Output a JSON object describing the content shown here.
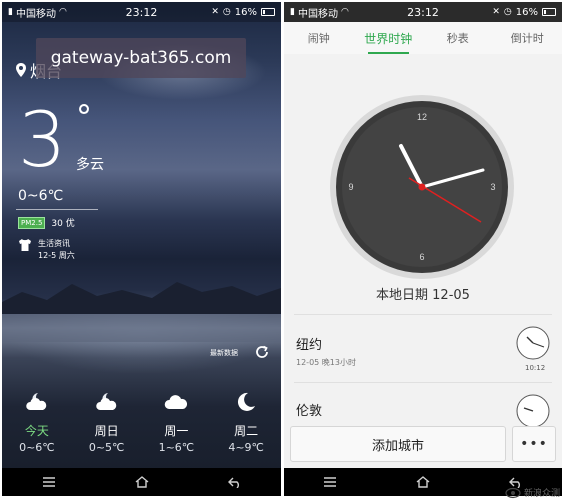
{
  "left": {
    "status": {
      "carrier": "中国移动",
      "time": "23:12",
      "battery": "16%"
    },
    "watermark": "gateway-bat365.com",
    "location": "烟台",
    "temperature": "3",
    "degree_symbol": "°",
    "condition": "多云",
    "range": "0~6℃",
    "aqi": {
      "badge": "PM2.5",
      "value": "30 优"
    },
    "life": {
      "title": "生活资讯",
      "date": "12-5 周六"
    },
    "latest_label": "最新数据",
    "forecast": [
      {
        "name": "今天",
        "range": "0~6℃",
        "icon": "cloudy-night-icon"
      },
      {
        "name": "周日",
        "range": "0~5℃",
        "icon": "cloudy-night-icon"
      },
      {
        "name": "周一",
        "range": "1~6℃",
        "icon": "cloud-icon"
      },
      {
        "name": "周二",
        "range": "4~9℃",
        "icon": "moon-icon"
      }
    ]
  },
  "right": {
    "status": {
      "carrier": "中国移动",
      "time": "23:12",
      "battery": "16%"
    },
    "tabs": [
      {
        "label": "闹钟"
      },
      {
        "label": "世界时钟"
      },
      {
        "label": "秒表"
      },
      {
        "label": "倒计时"
      }
    ],
    "clock_numbers": {
      "twelve": "12",
      "three": "3",
      "six": "6",
      "nine": "9"
    },
    "local_date": "本地日期 12-05",
    "cities": [
      {
        "name": "纽约",
        "sub": "12-05  晚13小时",
        "time": "10:12"
      },
      {
        "name": "伦敦",
        "sub": "",
        "time": ""
      }
    ],
    "add_city": "添加城市",
    "more": "•••"
  },
  "logo_text": "新浪众测",
  "colors": {
    "accent": "#2fa84f",
    "today": "#7ddc83",
    "aqi": "#4caf50",
    "second_hand": "#e02020"
  }
}
